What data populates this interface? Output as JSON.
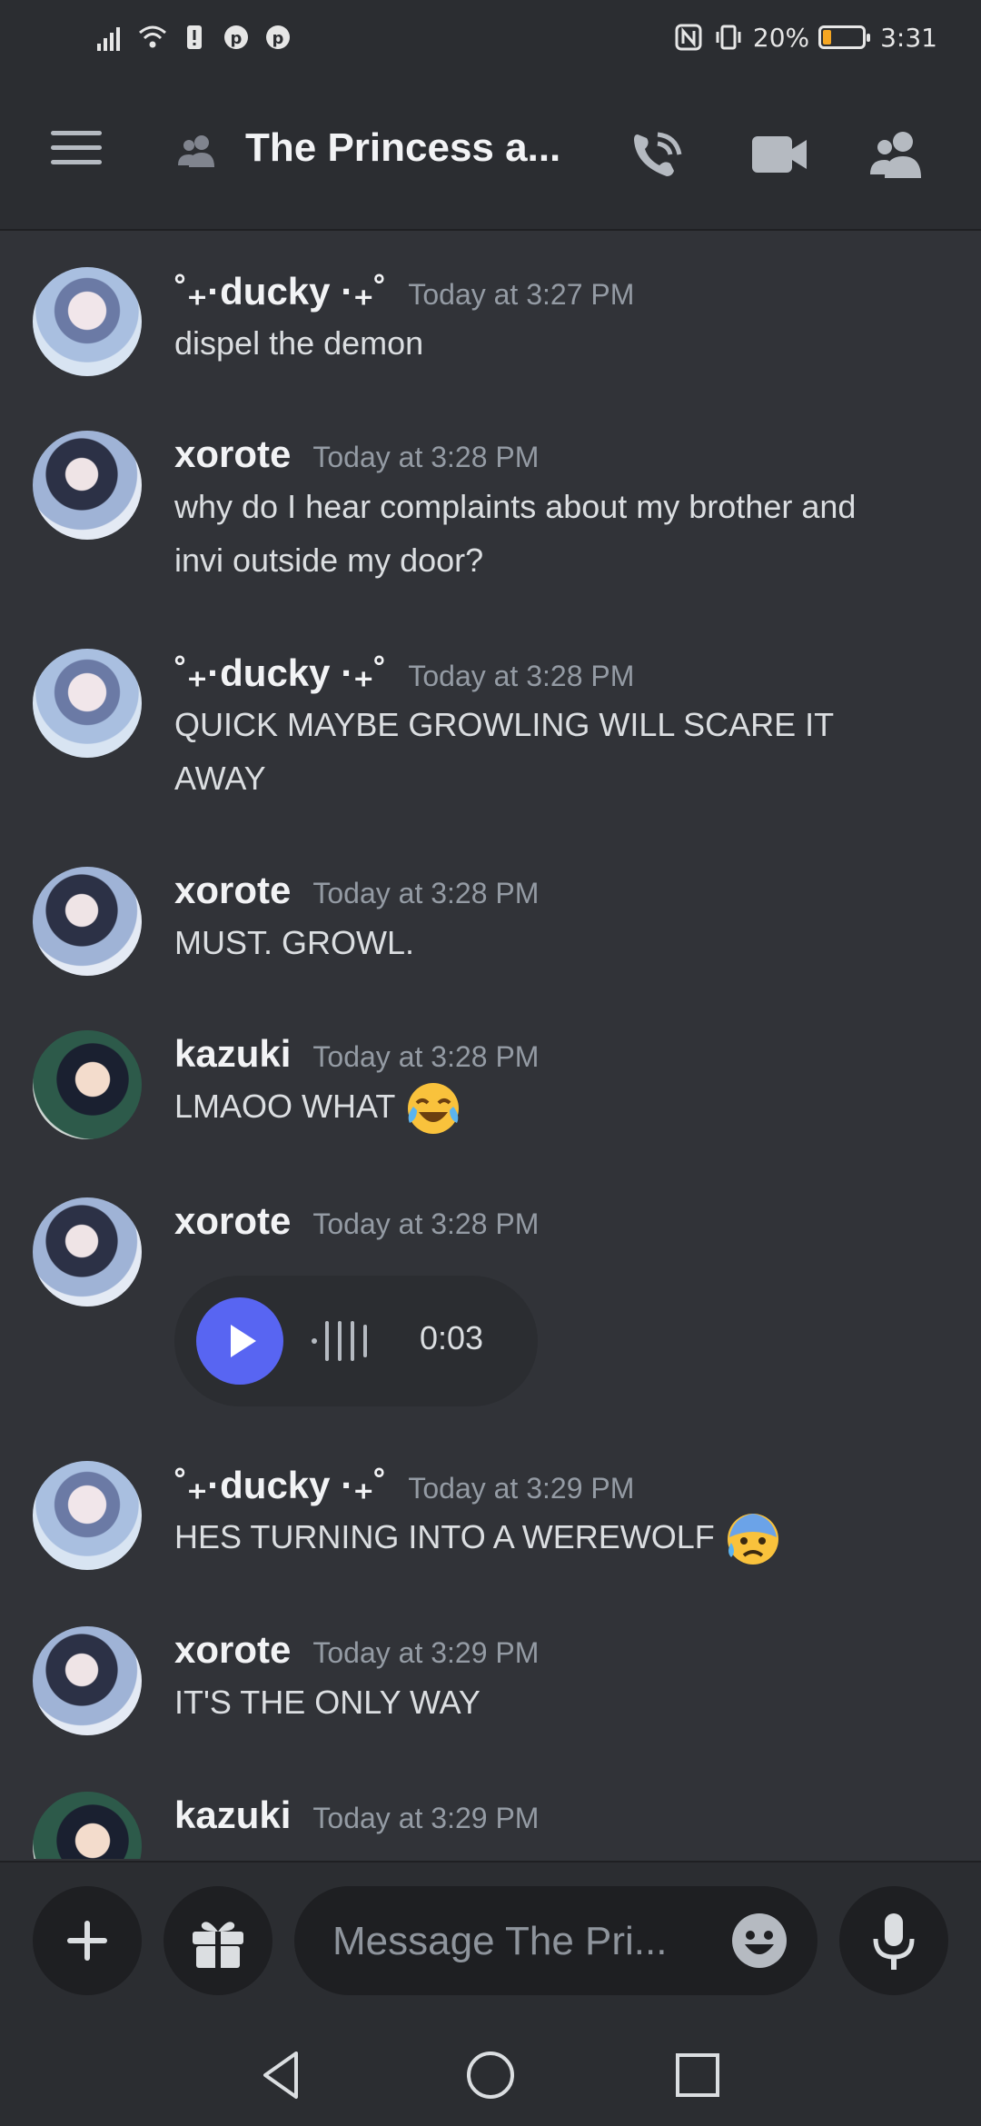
{
  "status_bar": {
    "battery_percent": "20%",
    "battery_level": 0.2,
    "time": "3:31",
    "battery_color": "#f5a623"
  },
  "header": {
    "menu_icon": "hamburger-menu-icon",
    "channel_icon": "people-icon",
    "title": "The Princess a...",
    "buttons": [
      "phone-call-icon",
      "video-camera-icon",
      "members-icon"
    ]
  },
  "messages": [
    {
      "author": "˚₊·ducky ·₊˚",
      "timestamp": "Today at 3:27 PM",
      "text": "dispel the demon",
      "avatar": "ducky-avatar"
    },
    {
      "author": "xorote",
      "timestamp": "Today at 3:28 PM",
      "lines": [
        "why do I hear complaints about my brother and",
        "invi outside my door?"
      ],
      "avatar": "xorote-avatar"
    },
    {
      "author": "˚₊·ducky ·₊˚",
      "timestamp": "Today at 3:28 PM",
      "lines": [
        "QUICK MAYBE GROWLING WILL SCARE IT",
        "AWAY"
      ],
      "avatar": "ducky-avatar"
    },
    {
      "author": "xorote",
      "timestamp": "Today at 3:28 PM",
      "text": "MUST. GROWL.",
      "avatar": "xorote-avatar"
    },
    {
      "author": "kazuki",
      "timestamp": "Today at 3:28 PM",
      "text": "LMAOO WHAT",
      "emoji": "face-with-tears-of-joy-icon",
      "avatar": "kazuki-avatar"
    },
    {
      "author": "xorote",
      "timestamp": "Today at 3:28 PM",
      "voice_duration": "0:03",
      "avatar": "xorote-avatar"
    },
    {
      "author": "˚₊·ducky ·₊˚",
      "timestamp": "Today at 3:29 PM",
      "text": "HES TURNING INTO A WEREWOLF",
      "emoji": "anxious-face-with-sweat-icon",
      "avatar": "ducky-avatar"
    },
    {
      "author": "xorote",
      "timestamp": "Today at 3:29 PM",
      "text": "IT'S THE ONLY WAY",
      "avatar": "xorote-avatar"
    },
    {
      "author": "kazuki",
      "timestamp": "Today at 3:29 PM",
      "avatar": "kazuki-avatar"
    }
  ],
  "composer": {
    "placeholder": "Message The Pri...",
    "buttons": [
      "plus-icon",
      "gift-icon",
      "emoji-icon",
      "microphone-icon"
    ]
  },
  "colors": {
    "background": "#313338",
    "header": "#2b2d31",
    "input": "#1e1f22",
    "accent": "#5865f2"
  }
}
